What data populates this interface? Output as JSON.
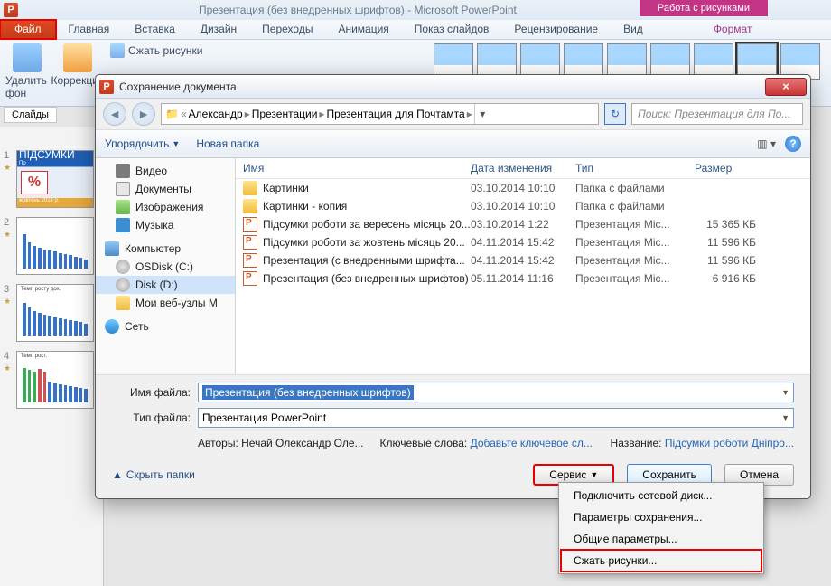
{
  "pp": {
    "title": "Презентация (без внедренных шрифтов)  -  Microsoft PowerPoint",
    "tooltab": "Работа с рисунками",
    "tabs": {
      "file": "Файл",
      "home": "Главная",
      "insert": "Вставка",
      "design": "Дизайн",
      "transitions": "Переходы",
      "animation": "Анимация",
      "slideshow": "Показ слайдов",
      "review": "Рецензирование",
      "view": "Вид",
      "format": "Формат"
    },
    "ribbon": {
      "removebg": "Удалить фон",
      "corrections": "Коррекция",
      "compress": "Сжать рисунки"
    },
    "slides_label": "Слайды",
    "slide1_pct": "%",
    "slide1_title": "ПІДСУМКИ",
    "slide1_sub": "По",
    "slide1_foot": "жовтень 2014 р."
  },
  "dlg": {
    "title": "Сохранение документа",
    "close_x": "×",
    "crumbs": [
      "Александр",
      "Презентации",
      "Презентация для Почтамта"
    ],
    "search_ph": "Поиск: Презентация для По...",
    "toolbar": {
      "organize": "Упорядочить",
      "newfolder": "Новая папка"
    },
    "nav": {
      "video": "Видео",
      "documents": "Документы",
      "images": "Изображения",
      "music": "Музыка",
      "computer": "Компьютер",
      "osdisk": "OSDisk (C:)",
      "diskd": "Disk (D:)",
      "myweb": "Мои веб-узлы M",
      "network": "Сеть"
    },
    "cols": {
      "name": "Имя",
      "date": "Дата изменения",
      "type": "Тип",
      "size": "Размер"
    },
    "files": [
      {
        "icon": "folder",
        "name": "Картинки",
        "date": "03.10.2014 10:10",
        "type": "Папка с файлами",
        "size": ""
      },
      {
        "icon": "folder",
        "name": "Картинки - копия",
        "date": "03.10.2014 10:10",
        "type": "Папка с файлами",
        "size": ""
      },
      {
        "icon": "pptx",
        "name": "Підсумки роботи за вересень місяць 20...",
        "date": "03.10.2014 1:22",
        "type": "Презентация Mic...",
        "size": "15 365 КБ"
      },
      {
        "icon": "pptx",
        "name": "Підсумки роботи за жовтень місяць 20...",
        "date": "04.11.2014 15:42",
        "type": "Презентация Mic...",
        "size": "11 596 КБ"
      },
      {
        "icon": "pptx",
        "name": "Презентация (с внедренными шрифта...",
        "date": "04.11.2014 15:42",
        "type": "Презентация Mic...",
        "size": "11 596 КБ"
      },
      {
        "icon": "pptx",
        "name": "Презентация (без внедренных шрифтов)",
        "date": "05.11.2014 11:16",
        "type": "Презентация Mic...",
        "size": "6 916 КБ"
      }
    ],
    "fn": {
      "name_lbl": "Имя файла:",
      "name_val": "Презентация (без внедренных шрифтов)",
      "type_lbl": "Тип файла:",
      "type_val": "Презентация PowerPoint",
      "authors_lbl": "Авторы:",
      "authors_val": "Нечай Олександр Оле...",
      "keywords_lbl": "Ключевые слова:",
      "keywords_val": "Добавьте ключевое сл...",
      "title_lbl": "Название:",
      "title_val": "Підсумки роботи Дніпро..."
    },
    "hide_folders": "Скрыть папки",
    "btn": {
      "service": "Сервис",
      "save": "Сохранить",
      "cancel": "Отмена"
    }
  },
  "svc": {
    "connect": "Подключить сетевой диск...",
    "saveopts": "Параметры сохранения...",
    "general": "Общие параметры...",
    "compress": "Сжать рисунки..."
  }
}
